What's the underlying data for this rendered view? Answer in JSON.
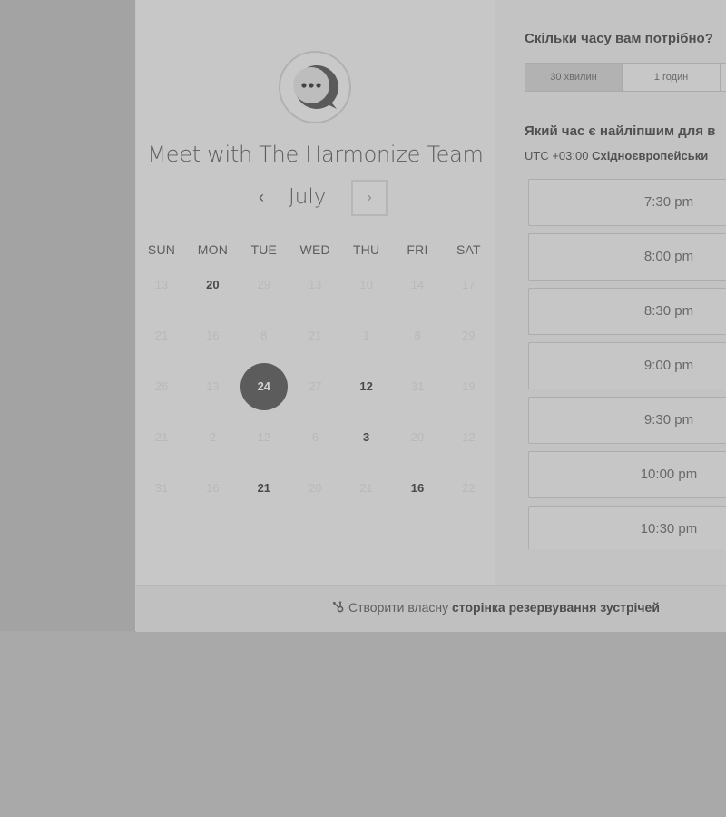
{
  "header": {
    "title": "Meet with The Harmonize Team",
    "avatar_icon": "chat-bubble-icon"
  },
  "calendar": {
    "month": "July",
    "prev_icon": "chevron-left-icon",
    "next_icon": "chevron-right-icon",
    "prev_glyph": "‹",
    "next_glyph": "›",
    "weekdays": [
      "SUN",
      "MON",
      "TUE",
      "WED",
      "THU",
      "FRI",
      "SAT"
    ],
    "weeks": [
      [
        {
          "d": "13",
          "s": "disabled"
        },
        {
          "d": "20",
          "s": "available"
        },
        {
          "d": "29",
          "s": "disabled"
        },
        {
          "d": "13",
          "s": "disabled"
        },
        {
          "d": "10",
          "s": "disabled"
        },
        {
          "d": "14",
          "s": "disabled"
        },
        {
          "d": "17",
          "s": "disabled"
        }
      ],
      [
        {
          "d": "21",
          "s": "disabled"
        },
        {
          "d": "16",
          "s": "disabled"
        },
        {
          "d": "8",
          "s": "disabled"
        },
        {
          "d": "21",
          "s": "disabled"
        },
        {
          "d": "1",
          "s": "disabled"
        },
        {
          "d": "8",
          "s": "disabled"
        },
        {
          "d": "29",
          "s": "disabled"
        }
      ],
      [
        {
          "d": "26",
          "s": "disabled"
        },
        {
          "d": "13",
          "s": "disabled"
        },
        {
          "d": "24",
          "s": "selected"
        },
        {
          "d": "27",
          "s": "disabled"
        },
        {
          "d": "12",
          "s": "available"
        },
        {
          "d": "31",
          "s": "disabled"
        },
        {
          "d": "19",
          "s": "disabled"
        }
      ],
      [
        {
          "d": "21",
          "s": "disabled"
        },
        {
          "d": "2",
          "s": "disabled"
        },
        {
          "d": "12",
          "s": "disabled"
        },
        {
          "d": "6",
          "s": "disabled"
        },
        {
          "d": "3",
          "s": "available"
        },
        {
          "d": "20",
          "s": "disabled"
        },
        {
          "d": "12",
          "s": "disabled"
        }
      ],
      [
        {
          "d": "31",
          "s": "disabled"
        },
        {
          "d": "16",
          "s": "disabled"
        },
        {
          "d": "21",
          "s": "available"
        },
        {
          "d": "20",
          "s": "disabled"
        },
        {
          "d": "21",
          "s": "disabled"
        },
        {
          "d": "16",
          "s": "available"
        },
        {
          "d": "22",
          "s": "disabled"
        }
      ]
    ]
  },
  "booking": {
    "duration_question": "Скільки часу вам потрібно?",
    "durations": [
      "30 хвилин",
      "1 годин",
      ""
    ],
    "active_duration": "30 хвилин",
    "time_question": "Який час є найліпшим для в",
    "timezone_offset": "UTC +03:00",
    "timezone_name": "Східноєвропейськи",
    "slots": [
      "7:30 pm",
      "8:00 pm",
      "8:30 pm",
      "9:00 pm",
      "9:30 pm",
      "10:00 pm",
      "10:30 pm"
    ]
  },
  "footer": {
    "icon": "hubspot-sprocket-icon",
    "text_prefix": "Створити власну",
    "text_bold": "сторінка резервування зустрічей"
  },
  "colors": {
    "overlay": "#a9a9a9",
    "panel": "#c7c7c7",
    "selected_day": "#5c5c5c"
  }
}
